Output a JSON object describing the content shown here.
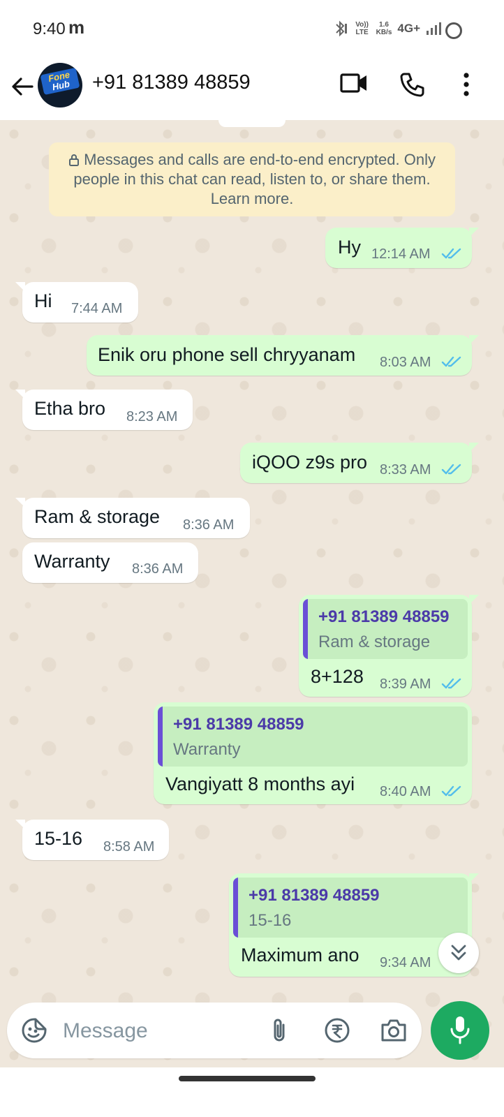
{
  "status_bar": {
    "time": "9:40",
    "carrier_glyph": "m",
    "volte": "Vo)) LTE",
    "speed_value": "1.6",
    "speed_unit": "KB/s",
    "network": "4G+"
  },
  "header": {
    "contact_name": "+91 81389 48859",
    "avatar_line1": "Fone",
    "avatar_line2": "Hub",
    "icons": [
      "back-arrow-icon",
      "video-call-icon",
      "voice-call-icon",
      "more-options-icon"
    ]
  },
  "encryption_notice": "Messages and calls are end-to-end encrypted. Only people in this chat can read, listen to, or share them. Learn more.",
  "messages": [
    {
      "direction": "out",
      "text": "Hy",
      "time": "12:14 AM",
      "read": true
    },
    {
      "direction": "in",
      "text": "Hi",
      "time": "7:44 AM"
    },
    {
      "direction": "out",
      "text": "Enik oru phone sell chryyanam",
      "time": "8:03 AM",
      "read": true
    },
    {
      "direction": "in",
      "text": "Etha bro",
      "time": "8:23 AM"
    },
    {
      "direction": "out",
      "text": "iQOO z9s pro",
      "time": "8:33 AM",
      "read": true
    },
    {
      "direction": "in",
      "text": "Ram & storage",
      "time": "8:36 AM"
    },
    {
      "direction": "in",
      "text": "Warranty",
      "time": "8:36 AM"
    },
    {
      "direction": "out",
      "quote_author": "+91 81389 48859",
      "quote_text": "Ram & storage",
      "text": "8+128",
      "time": "8:39 AM",
      "read": true
    },
    {
      "direction": "out",
      "quote_author": "+91 81389 48859",
      "quote_text": "Warranty",
      "text": "Vangiyatt 8 months ayi",
      "time": "8:40 AM",
      "read": true
    },
    {
      "direction": "in",
      "text": "15-16",
      "time": "8:58 AM"
    },
    {
      "direction": "out",
      "quote_author": "+91 81389 48859",
      "quote_text": "15-16",
      "text": "Maximum ano",
      "time": "9:34 AM"
    }
  ],
  "composer": {
    "placeholder": "Message",
    "icons": [
      "sticker-icon",
      "attach-icon",
      "rupee-payment-icon",
      "camera-icon",
      "mic-icon"
    ]
  },
  "colors": {
    "chat_background": "#efe7dc",
    "outgoing_bubble": "#d8fdd2",
    "incoming_bubble": "#ffffff",
    "read_ticks": "#53bdeb",
    "quote_bar": "#6a4fd6",
    "mic_button": "#1daa61"
  }
}
